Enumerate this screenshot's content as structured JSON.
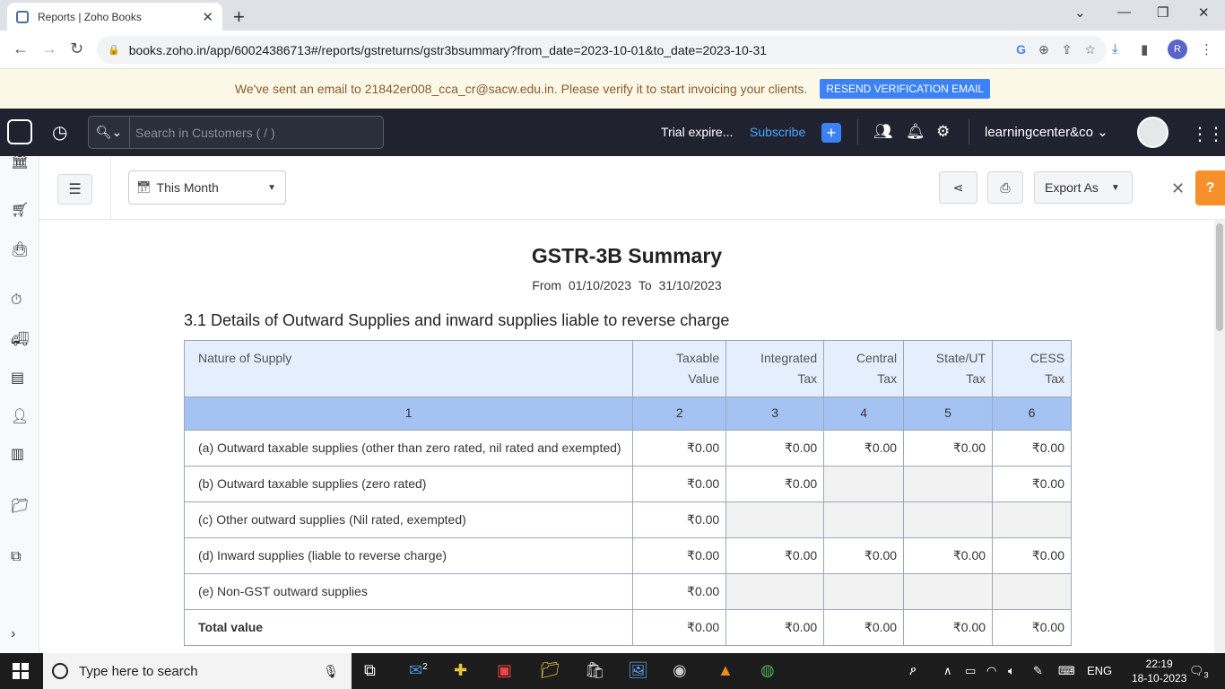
{
  "browser": {
    "tab_title": "Reports | Zoho Books",
    "url": "books.zoho.in/app/60024386713#/reports/gstreturns/gstr3bsummary?from_date=2023-10-01&to_date=2023-10-31",
    "profile_initial": "R"
  },
  "banner": {
    "message": "We've sent an email to 21842er008_cca_cr@sacw.edu.in. Please verify it to start invoicing your clients.",
    "button": "RESEND VERIFICATION EMAIL"
  },
  "header": {
    "search_placeholder": "Search in Customers ( / )",
    "trial": "Trial expire...",
    "subscribe": "Subscribe",
    "org": "learningcenter&co"
  },
  "toolbar": {
    "period": "This Month",
    "export": "Export As"
  },
  "report": {
    "title": "GSTR-3B Summary",
    "from_label": "From",
    "from_date": "01/10/2023",
    "to_label": "To",
    "to_date": "31/10/2023",
    "section_title": "3.1 Details of Outward Supplies and inward supplies liable to reverse charge",
    "columns": [
      {
        "line1": "Nature of Supply",
        "line2": ""
      },
      {
        "line1": "Taxable",
        "line2": "Value"
      },
      {
        "line1": "Integrated",
        "line2": "Tax"
      },
      {
        "line1": "Central",
        "line2": "Tax"
      },
      {
        "line1": "State/UT",
        "line2": "Tax"
      },
      {
        "line1": "CESS",
        "line2": "Tax"
      }
    ],
    "column_numbers": [
      "1",
      "2",
      "3",
      "4",
      "5",
      "6"
    ],
    "rows": [
      {
        "label": "(a) Outward taxable supplies (other than zero rated, nil rated and exempted)",
        "values": [
          "₹0.00",
          "₹0.00",
          "₹0.00",
          "₹0.00",
          "₹0.00"
        ]
      },
      {
        "label": "(b) Outward taxable supplies (zero rated)",
        "values": [
          "₹0.00",
          "₹0.00",
          "",
          "",
          "₹0.00"
        ]
      },
      {
        "label": "(c) Other outward supplies (Nil rated, exempted)",
        "values": [
          "₹0.00",
          "",
          "",
          "",
          ""
        ]
      },
      {
        "label": "(d) Inward supplies (liable to reverse charge)",
        "values": [
          "₹0.00",
          "₹0.00",
          "₹0.00",
          "₹0.00",
          "₹0.00"
        ]
      },
      {
        "label": "(e) Non-GST outward supplies",
        "values": [
          "₹0.00",
          "",
          "",
          "",
          ""
        ]
      },
      {
        "label": "Total value",
        "values": [
          "₹0.00",
          "₹0.00",
          "₹0.00",
          "₹0.00",
          "₹0.00"
        ]
      }
    ]
  },
  "taskbar": {
    "search_placeholder": "Type here to search",
    "mail_badge": "2",
    "language": "ENG",
    "time": "22:19",
    "date": "18-10-2023",
    "notif_count": "3"
  },
  "icons": {
    "back": "arrow-left-icon",
    "forward": "arrow-right-icon",
    "reload": "reload-icon",
    "search": "search-icon",
    "share": "share-icon",
    "print": "print-icon",
    "bell": "bell-icon",
    "gear": "gear-icon"
  }
}
